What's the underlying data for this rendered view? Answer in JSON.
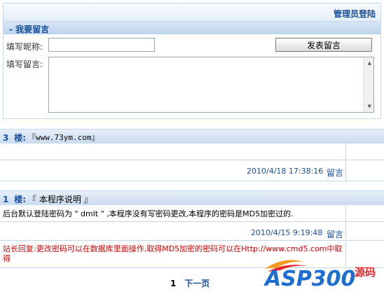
{
  "header": {
    "admin_login": "管理员登陆"
  },
  "post_form": {
    "title": "- 我要留言",
    "nickname_label": "填写昵称:",
    "nickname_value": "",
    "message_label": "填写留言:",
    "message_value": "",
    "submit_label": "发表留言"
  },
  "entries": [
    {
      "floor": "3",
      "floor_suffix": "楼:",
      "title": "『www.73ym.com』",
      "body": "",
      "timestamp": "2010/4/18 17:38:16",
      "reply_label": "留言"
    },
    {
      "floor": "1",
      "floor_suffix": "楼:",
      "title": "『 本程序说明 』",
      "body": "后台默认登陆密码为 \" dmlt \" ,本程序没有写密码更改,本程序的密码是MD5加密过的.",
      "timestamp": "2010/4/15 9:19:48",
      "reply_label": "留言",
      "admin_reply": "站长回复:更改密码可以在数据库里面操作,取得MD5加密的密码可以在Http://www.cmd5.com中取得"
    }
  ],
  "pagination": {
    "current": "1",
    "next_label": "下一页"
  },
  "watermark": {
    "brand": "ASP300",
    "suffix": "源码",
    "brand_color": "#1c6fd1",
    "accent_color": "#e8262a"
  }
}
